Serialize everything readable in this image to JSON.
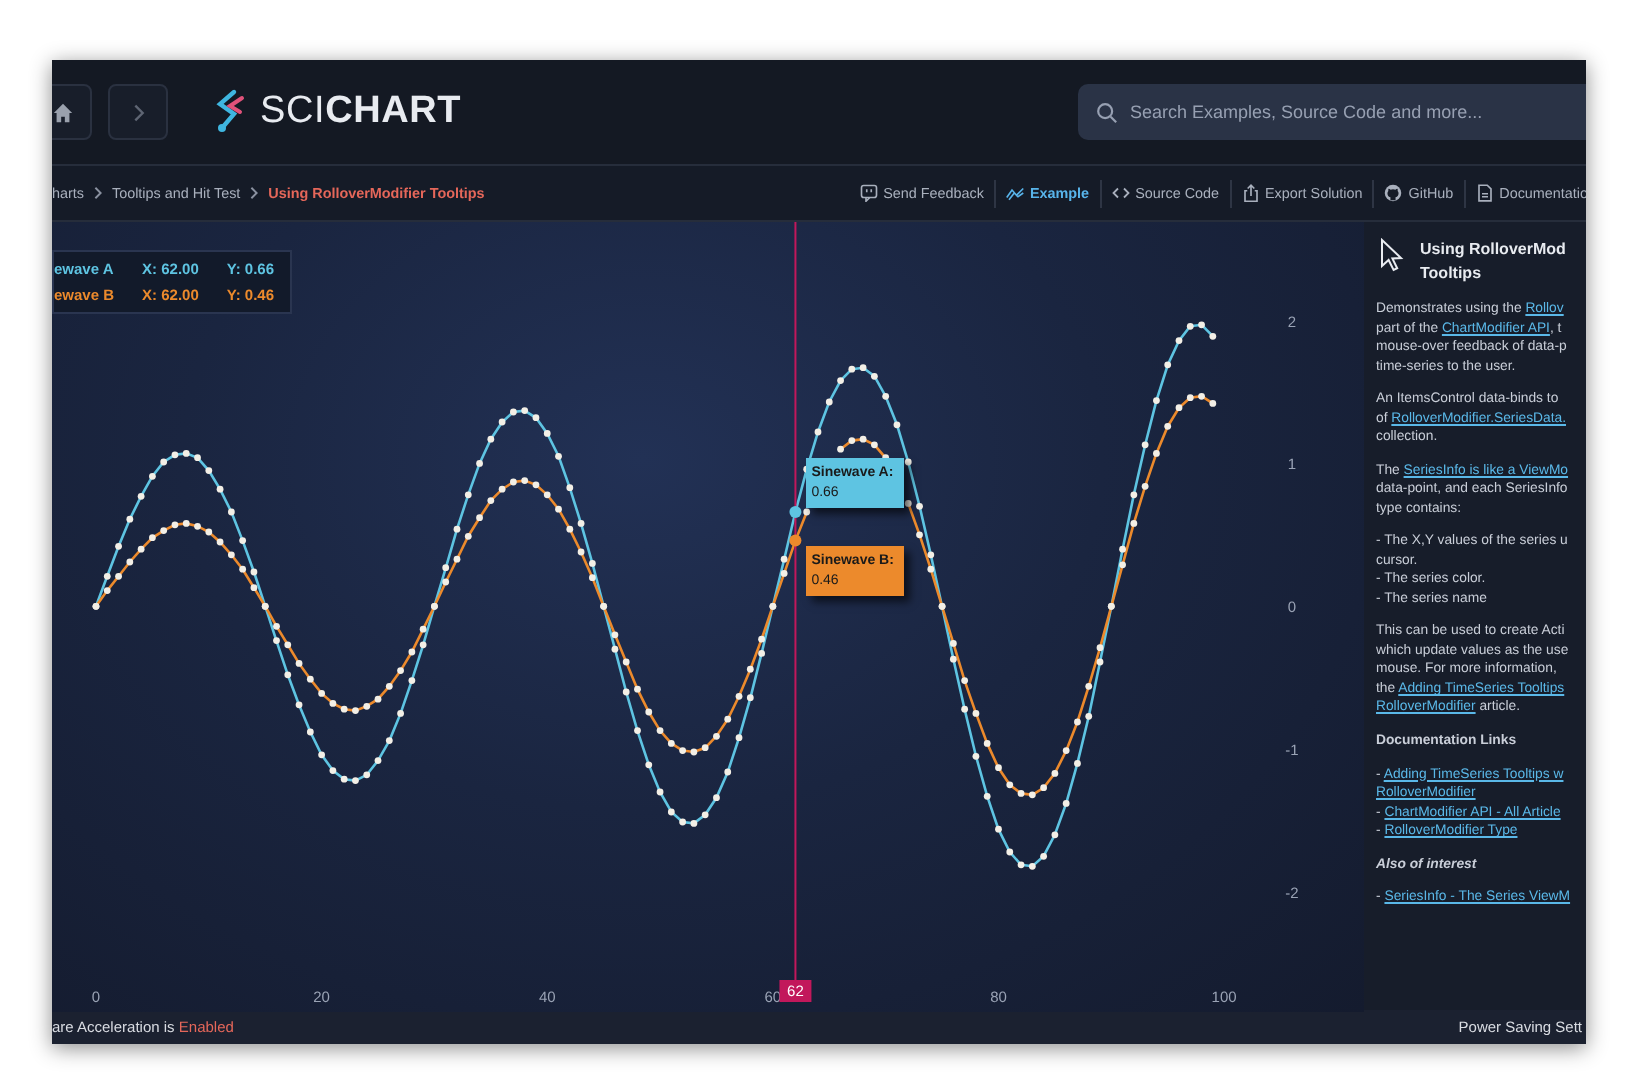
{
  "header": {
    "logo": "SCI**CHART**",
    "search": {
      "placeholder": "Search Examples, Source Code and more..."
    }
  },
  "breadcrumb": [
    {
      "label": "harts",
      "selected": false
    },
    {
      "label": "Tooltips and Hit Test",
      "selected": false
    },
    {
      "label": "Using RolloverModifier Tooltips",
      "selected": true
    }
  ],
  "toolbar": [
    {
      "label": "Send Feedback",
      "selected": false
    },
    {
      "label": "Example",
      "selected": true
    },
    {
      "label": "Source Code",
      "selected": false
    },
    {
      "label": "Export Solution",
      "selected": false
    },
    {
      "label": "GitHub",
      "selected": false
    },
    {
      "label": "Documentatio",
      "selected": false
    }
  ],
  "chart": {
    "legend": [
      {
        "name": "ewave A",
        "x": "X: 62.00",
        "y": "Y: 0.66"
      },
      {
        "name": "ewave B",
        "x": "X: 62.00",
        "y": "Y: 0.46"
      }
    ],
    "tooltips": [
      {
        "name_suffix": ":",
        "value": "0.66"
      },
      {
        "name_suffix": ":",
        "value": "0.46"
      }
    ],
    "chart_data": {
      "type": "line",
      "xlim": [
        -3.9,
        112.4
      ],
      "ylim": [
        -2.84,
        2.69
      ],
      "xticks": [
        0,
        20,
        40,
        60,
        80,
        100
      ],
      "yticks": [
        -2,
        -1,
        0,
        1,
        2
      ],
      "ref_lines": [
        {
          "axis": "x",
          "value": 62,
          "label": "62"
        }
      ],
      "x": [
        0,
        1,
        2,
        3,
        4,
        5,
        6,
        7,
        8,
        9,
        10,
        11,
        12,
        13,
        14,
        15,
        16,
        17,
        18,
        19,
        20,
        21,
        22,
        23,
        24,
        25,
        26,
        27,
        28,
        29,
        30,
        31,
        32,
        33,
        34,
        35,
        36,
        37,
        38,
        39,
        40,
        41,
        42,
        43,
        44,
        45,
        46,
        47,
        48,
        49,
        50,
        51,
        52,
        53,
        54,
        55,
        56,
        57,
        58,
        59,
        60,
        61,
        62,
        63,
        64,
        65,
        66,
        67,
        68,
        69,
        70,
        71,
        72,
        73,
        74,
        75,
        76,
        77,
        78,
        79,
        80,
        81,
        82,
        83,
        84,
        85,
        86,
        87,
        88,
        89,
        90,
        91,
        92,
        93,
        94,
        95,
        96,
        97,
        98,
        99
      ],
      "series": [
        {
          "name": "Sinewave A",
          "color": "#5ec4e2",
          "marker": "circle",
          "values": [
            0,
            0.21,
            0.42,
            0.61,
            0.77,
            0.91,
            1.01,
            1.06,
            1.07,
            1.04,
            0.95,
            0.82,
            0.66,
            0.46,
            0.24,
            0,
            -0.24,
            -0.48,
            -0.69,
            -0.88,
            -1.04,
            -1.15,
            -1.21,
            -1.22,
            -1.18,
            -1.08,
            -0.94,
            -0.75,
            -0.52,
            -0.27,
            0,
            0.27,
            0.54,
            0.78,
            1.0,
            1.17,
            1.29,
            1.36,
            1.37,
            1.32,
            1.21,
            1.05,
            0.83,
            0.58,
            0.3,
            0,
            -0.3,
            -0.6,
            -0.87,
            -1.11,
            -1.3,
            -1.44,
            -1.51,
            -1.52,
            -1.46,
            -1.34,
            -1.16,
            -0.92,
            -0.64,
            -0.33,
            0,
            0.33,
            0.66,
            0.96,
            1.22,
            1.43,
            1.58,
            1.66,
            1.67,
            1.61,
            1.47,
            1.27,
            1.01,
            0.7,
            0.36,
            0,
            -0.37,
            -0.72,
            -1.05,
            -1.33,
            -1.56,
            -1.72,
            -1.81,
            -1.82,
            -1.75,
            -1.6,
            -1.38,
            -1.1,
            -0.77,
            -0.39,
            0,
            0.4,
            0.78,
            1.13,
            1.44,
            1.69,
            1.86,
            1.96,
            1.97,
            1.89
          ]
        },
        {
          "name": "Sinewave B",
          "color": "#ec8a2c",
          "marker": "circle",
          "values": [
            0,
            0.11,
            0.21,
            0.31,
            0.4,
            0.48,
            0.53,
            0.57,
            0.58,
            0.56,
            0.52,
            0.45,
            0.36,
            0.26,
            0.13,
            0,
            -0.14,
            -0.27,
            -0.4,
            -0.51,
            -0.61,
            -0.68,
            -0.72,
            -0.73,
            -0.7,
            -0.65,
            -0.56,
            -0.45,
            -0.32,
            -0.16,
            0,
            0.17,
            0.33,
            0.49,
            0.62,
            0.74,
            0.82,
            0.87,
            0.88,
            0.85,
            0.78,
            0.68,
            0.54,
            0.38,
            0.2,
            0,
            -0.2,
            -0.39,
            -0.58,
            -0.74,
            -0.87,
            -0.96,
            -1.01,
            -1.02,
            -0.99,
            -0.91,
            -0.79,
            -0.63,
            -0.44,
            -0.23,
            0,
            0.23,
            0.46,
            0.66,
            null,
            null,
            1.1,
            1.16,
            1.17,
            1.13,
            1.04,
            null,
            0.72,
            0.5,
            0.26,
            0,
            -0.26,
            -0.52,
            -0.75,
            -0.96,
            -1.13,
            -1.25,
            -1.31,
            -1.32,
            -1.27,
            -1.17,
            -1.01,
            -0.81,
            -0.56,
            -0.29,
            0,
            0.29,
            0.58,
            0.84,
            1.07,
            1.26,
            1.39,
            1.46,
            1.47,
            1.42
          ]
        }
      ]
    }
  },
  "panel": {
    "title": [
      "Using RolloverMod",
      "Tooltips"
    ],
    "paragraphs": [
      {
        "kind": "text",
        "lines": [
          [
            {
              "text": "Demonstrates using the ",
              "link": false
            },
            {
              "text": "Rollov",
              "link": true
            }
          ],
          [
            {
              "text": "part of the ",
              "link": false
            },
            {
              "text": "ChartModifier API",
              "link": true
            },
            {
              "text": ", t",
              "link": false
            }
          ],
          [
            {
              "text": "mouse-over feedback of data-p",
              "link": false
            }
          ],
          [
            {
              "text": "time-series to the user.",
              "link": false
            }
          ]
        ]
      },
      {
        "kind": "text",
        "lines": [
          [
            {
              "text": "An ItemsControl data-binds to",
              "link": false
            }
          ],
          [
            {
              "text": "of ",
              "link": false
            },
            {
              "text": "RolloverModifier.SeriesData.",
              "link": true
            }
          ],
          [
            {
              "text": "collection.",
              "link": false
            }
          ]
        ]
      },
      {
        "kind": "text",
        "lines": [
          [
            {
              "text": "The ",
              "link": false
            },
            {
              "text": "SeriesInfo is like a ViewMo",
              "link": true
            }
          ],
          [
            {
              "text": "data-point, and each SeriesInfo",
              "link": false
            }
          ],
          [
            {
              "text": "type contains:",
              "link": false
            }
          ]
        ]
      },
      {
        "kind": "text",
        "lines": [
          [
            {
              "text": "- The X,Y values of the series u",
              "link": false
            }
          ],
          [
            {
              "text": "cursor.",
              "link": false
            }
          ],
          [
            {
              "text": "- The series color.",
              "link": false
            }
          ],
          [
            {
              "text": "- The series name",
              "link": false
            }
          ]
        ]
      },
      {
        "kind": "text",
        "lines": [
          [
            {
              "text": "This can be used to create Acti",
              "link": false
            }
          ],
          [
            {
              "text": "which update values as the use",
              "link": false
            }
          ],
          [
            {
              "text": "mouse. For more information,",
              "link": false
            }
          ],
          [
            {
              "text": "the ",
              "link": false
            },
            {
              "text": "Adding TimeSeries Tooltips",
              "link": true
            }
          ],
          [
            {
              "text": "RolloverModifier",
              "link": true
            },
            {
              "text": " article.",
              "link": false
            }
          ]
        ]
      },
      {
        "kind": "heading",
        "lines": [
          [
            {
              "text": "Documentation Links",
              "link": false
            }
          ]
        ]
      },
      {
        "kind": "text",
        "lines": [
          [
            {
              "text": "- ",
              "link": false
            },
            {
              "text": "Adding TimeSeries Tooltips w",
              "link": true
            }
          ],
          [
            {
              "text": "RolloverModifier",
              "link": true
            }
          ],
          [
            {
              "text": "- ",
              "link": false
            },
            {
              "text": "ChartModifier API - All Article",
              "link": true
            }
          ],
          [
            {
              "text": "- ",
              "link": false
            },
            {
              "text": "RolloverModifier Type",
              "link": true
            }
          ]
        ]
      },
      {
        "kind": "subheading",
        "lines": [
          [
            {
              "text": "Also of interest",
              "link": false
            }
          ]
        ]
      },
      {
        "kind": "text",
        "lines": [
          [
            {
              "text": "- ",
              "link": false
            },
            {
              "text": "SeriesInfo - The Series ViewM",
              "link": true
            }
          ]
        ]
      }
    ]
  },
  "status": {
    "label": "are Acceleration is",
    "value": "Enabled",
    "right": "Power Saving Sett"
  }
}
